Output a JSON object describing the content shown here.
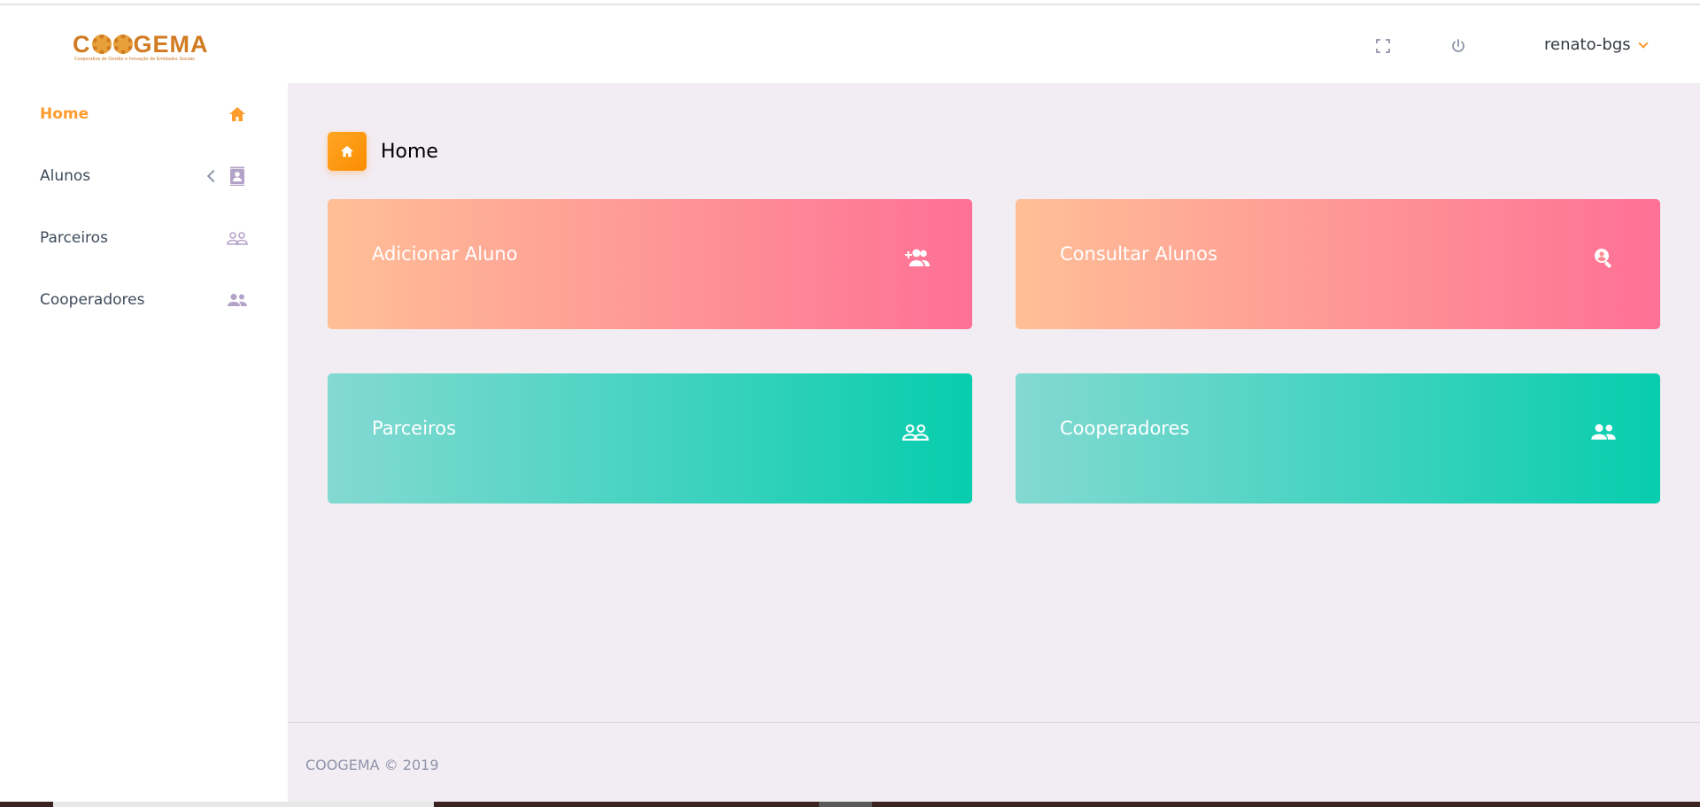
{
  "brand": {
    "name_left": "C",
    "name_right": "GEMA",
    "tagline": "Cooperativa de Gestão e Inovação de Entidades Sociais"
  },
  "navbar": {
    "fullscreen_icon": "fullscreen-icon",
    "power_icon": "power-icon",
    "username": "renato-bgs"
  },
  "sidebar": {
    "items": [
      {
        "label": "Home",
        "icon": "home-icon",
        "active": true
      },
      {
        "label": "Alunos",
        "icon": "contacts-icon",
        "active": false,
        "has_submenu": true
      },
      {
        "label": "Parceiros",
        "icon": "people-outline-icon",
        "active": false
      },
      {
        "label": "Cooperadores",
        "icon": "people-icon",
        "active": false
      }
    ]
  },
  "page": {
    "title": "Home",
    "title_icon": "home-icon"
  },
  "cards": [
    {
      "label": "Adicionar Aluno",
      "icon": "add-user-icon",
      "color": "pink"
    },
    {
      "label": "Consultar Alunos",
      "icon": "search-user-icon",
      "color": "pink"
    },
    {
      "label": "Parceiros",
      "icon": "people-outline-icon",
      "color": "green"
    },
    {
      "label": "Cooperadores",
      "icon": "people-icon",
      "color": "green"
    }
  ],
  "footer": {
    "text": "COOGEMA © 2019"
  },
  "colors": {
    "accent": "#fe9c2d",
    "pink_start": "#ffbf96",
    "pink_end": "#fe7096",
    "green_start": "#84d9d2",
    "green_end": "#07cdae",
    "background": "#f2edf3"
  }
}
